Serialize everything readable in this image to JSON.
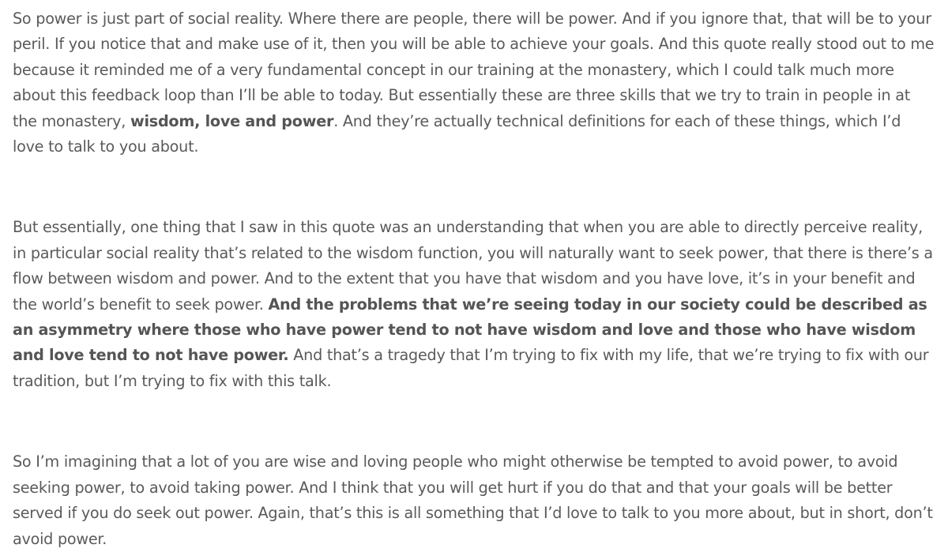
{
  "paragraphs": [
    {
      "segments": [
        {
          "text": "So power is just part of social reality. Where there are people, there will be power. And if you ignore that, that will be to your peril. If you notice that and make use of it, then you will be able to achieve your goals. And this quote really stood out to me because it reminded me of a very fundamental concept in our training at the monastery, which I could talk much more about this feedback loop than I’ll be able to today. But essentially these are three skills that we try to train in people in at the monastery, "
        },
        {
          "text": "wisdom, love and power"
        },
        {
          "text": ". And they’re actually technical definitions for each of these things, which I’d love to talk to you about."
        }
      ]
    },
    {
      "segments": [
        {
          "text": "But essentially, one thing that I saw in this quote was an understanding that when you are able to directly perceive reality, in particular social reality that’s related to the wisdom function, you will naturally want to seek power, that there is there’s a flow between wisdom and power. And to the extent that you have that wisdom and you have love, it’s in your benefit and the world’s benefit to seek power. "
        },
        {
          "text": "And the problems that we’re seeing today in our society could be described as an asymmetry where those who have power tend to not have wisdom and love and those who have wisdom and love tend to not have power."
        },
        {
          "text": " And that’s a tragedy that I’m trying to fix with my life, that we’re trying to fix with our tradition, but I’m trying to fix with this talk."
        }
      ]
    },
    {
      "segments": [
        {
          "text": "So I’m imagining that a lot of you are wise and loving people who might otherwise be tempted to avoid power, to avoid seeking power, to avoid taking power. And I think that you will get hurt if you do that and that your goals will be better served if you do seek out power. Again, that’s this is all something that I’d love to talk to you more about, but in short, don’t avoid power."
        }
      ]
    }
  ]
}
